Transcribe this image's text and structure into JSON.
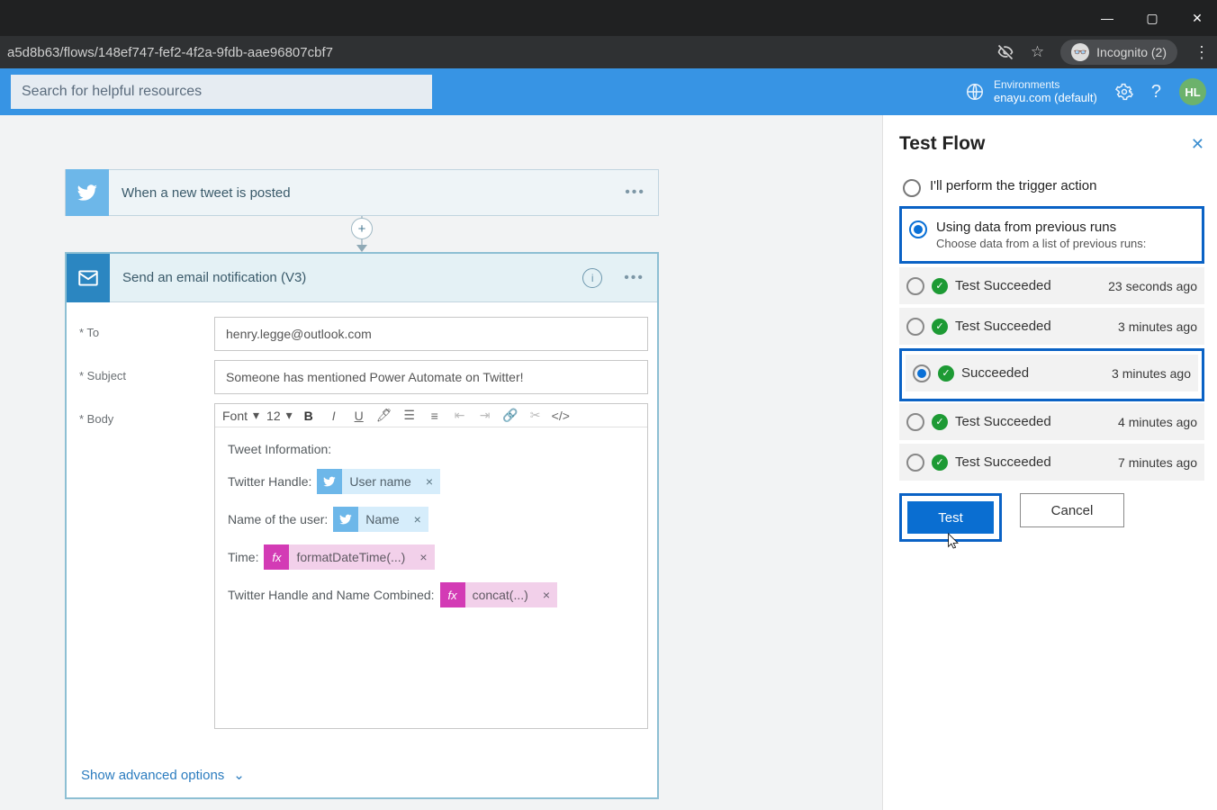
{
  "browser": {
    "url": "a5d8b63/flows/148ef747-fef2-4f2a-9fdb-aae96807cbf7",
    "incognito_label": "Incognito (2)"
  },
  "header": {
    "search_placeholder": "Search for helpful resources",
    "env_label": "Environments",
    "env_value": "enayu.com (default)",
    "avatar": "HL"
  },
  "flow": {
    "trigger_title": "When a new tweet is posted",
    "email_title": "Send an email notification (V3)",
    "labels": {
      "to": "* To",
      "subject": "* Subject",
      "body": "* Body"
    },
    "to_value": "henry.legge@outlook.com",
    "subject_value": "Someone has mentioned Power Automate on Twitter!",
    "toolbar": {
      "font": "Font",
      "size": "12"
    },
    "body": {
      "heading": "Tweet Information:",
      "l1": "Twitter Handle:",
      "chip_username": "User name",
      "l2": "Name of the user:",
      "chip_name": "Name",
      "l3": "Time:",
      "chip_time": "formatDateTime(...)",
      "l4": "Twitter Handle and Name Combined:",
      "chip_concat": "concat(...)"
    },
    "advanced": "Show advanced options"
  },
  "panel": {
    "title": "Test Flow",
    "opt1": "I'll perform the trigger action",
    "opt2": "Using data from previous runs",
    "opt2_sub": "Choose data from a list of previous runs:",
    "runs": [
      {
        "label": "Test Succeeded",
        "time": "23 seconds ago",
        "selected": false
      },
      {
        "label": "Test Succeeded",
        "time": "3 minutes ago",
        "selected": false
      },
      {
        "label": "Succeeded",
        "time": "3 minutes ago",
        "selected": true
      },
      {
        "label": "Test Succeeded",
        "time": "4 minutes ago",
        "selected": false
      },
      {
        "label": "Test Succeeded",
        "time": "7 minutes ago",
        "selected": false
      }
    ],
    "test": "Test",
    "cancel": "Cancel"
  }
}
